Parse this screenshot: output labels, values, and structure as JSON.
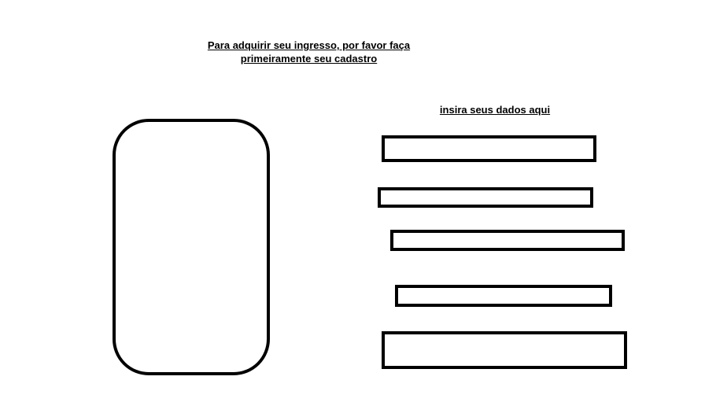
{
  "header": {
    "line1": "Para adquirir seu ingresso, por favor faça",
    "line2": "primeiramente seu cadastro"
  },
  "form": {
    "caption": "insira seus dados aqui",
    "fields": [
      {
        "value": "",
        "placeholder": ""
      },
      {
        "value": "",
        "placeholder": ""
      },
      {
        "value": "",
        "placeholder": ""
      },
      {
        "value": "",
        "placeholder": ""
      },
      {
        "value": "",
        "placeholder": ""
      }
    ]
  },
  "colors": {
    "stroke": "#000000",
    "background": "#ffffff"
  }
}
